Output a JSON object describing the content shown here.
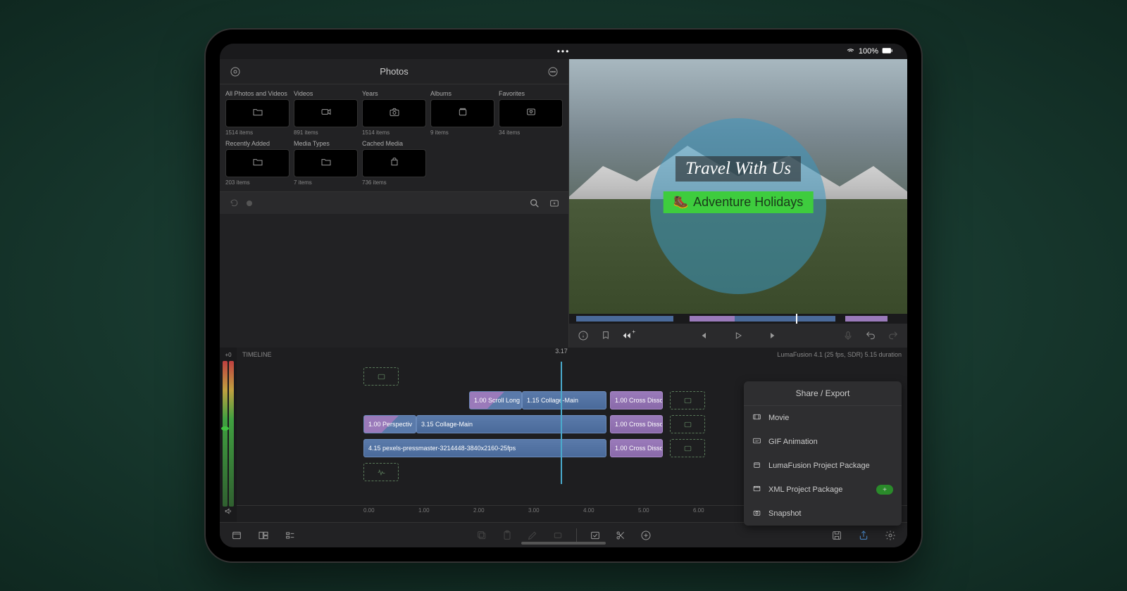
{
  "status": {
    "battery": "100%"
  },
  "media": {
    "title": "Photos",
    "items": [
      {
        "label": "All Photos and Videos",
        "count": "1514 items",
        "icon": "folder"
      },
      {
        "label": "Videos",
        "count": "891 items",
        "icon": "video"
      },
      {
        "label": "Years",
        "count": "1514 items",
        "icon": "camera"
      },
      {
        "label": "Albums",
        "count": "9 items",
        "icon": "album"
      },
      {
        "label": "Favorites",
        "count": "34 items",
        "icon": "heart"
      },
      {
        "label": "Recently Added",
        "count": "203 items",
        "icon": "folder"
      },
      {
        "label": "Media Types",
        "count": "7 items",
        "icon": "folder"
      },
      {
        "label": "Cached Media",
        "count": "736 items",
        "icon": "package"
      }
    ]
  },
  "preview": {
    "title_overlay": "Travel With Us",
    "subtitle_overlay": "Adventure Holidays"
  },
  "timeline": {
    "label": "TIMELINE",
    "playhead_time": "3.17",
    "info": "LumaFusion 4.1 (25 fps, SDR)  5.15 duration",
    "meter_label": "+0",
    "clips": {
      "r1_c1": "1.00  Scroll Long",
      "r1_c2": "1.15  Collage-Main",
      "r1_c3": "1.00  Cross Disso",
      "r2_c1": "1.00  Perspectiv",
      "r2_c2": "3.15  Collage-Main",
      "r2_c3": "1.00  Cross Disso",
      "r3_c1": "4.15  pexels-pressmaster-3214448-3840x2160-25fps",
      "r3_c2": "1.00  Cross Disso"
    },
    "ruler": [
      "0.00",
      "1.00",
      "2.00",
      "3.00",
      "4.00",
      "5.00",
      "6.00"
    ]
  },
  "export": {
    "title": "Share / Export",
    "items": [
      {
        "label": "Movie",
        "icon": "movie",
        "badge": ""
      },
      {
        "label": "GIF Animation",
        "icon": "gif",
        "badge": ""
      },
      {
        "label": "LumaFusion Project Package",
        "icon": "package",
        "badge": ""
      },
      {
        "label": "XML Project Package",
        "icon": "xml",
        "badge": "+"
      },
      {
        "label": "Snapshot",
        "icon": "snapshot",
        "badge": ""
      }
    ]
  }
}
